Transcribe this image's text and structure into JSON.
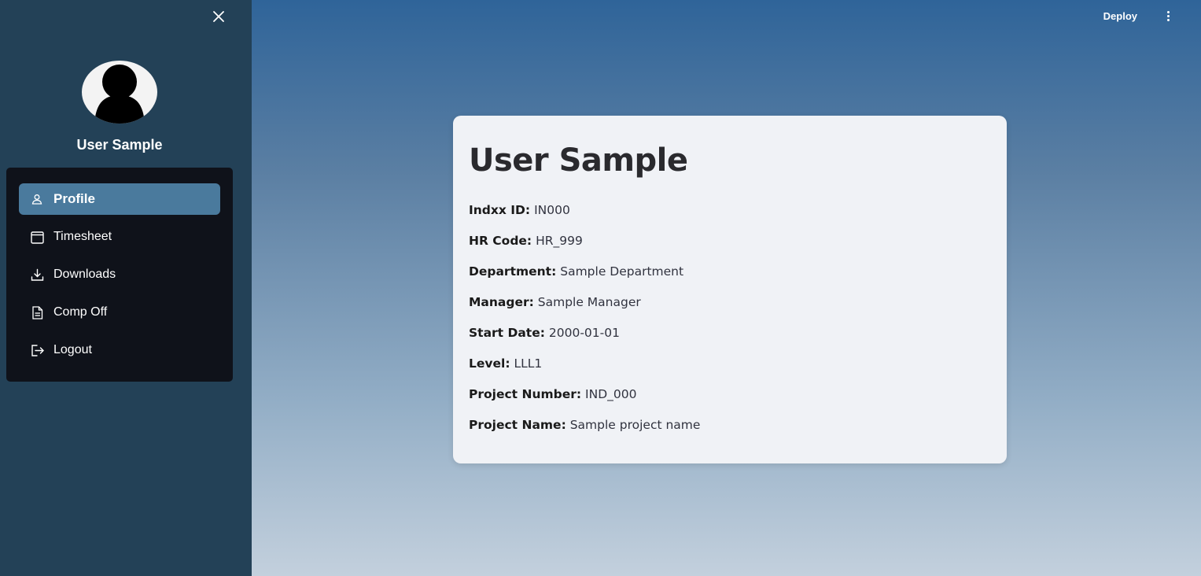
{
  "sidebar": {
    "user_name": "User Sample",
    "items": [
      {
        "label": "Profile",
        "icon": "person-icon",
        "active": true
      },
      {
        "label": "Timesheet",
        "icon": "calendar-icon",
        "active": false
      },
      {
        "label": "Downloads",
        "icon": "download-icon",
        "active": false
      },
      {
        "label": "Comp Off",
        "icon": "document-icon",
        "active": false
      },
      {
        "label": "Logout",
        "icon": "logout-icon",
        "active": false
      }
    ]
  },
  "topbar": {
    "deploy_label": "Deploy",
    "menu_icon": "vertical-dots-icon"
  },
  "profile": {
    "title": "User Sample",
    "fields": [
      {
        "label": "Indxx ID:",
        "value": "IN000"
      },
      {
        "label": "HR Code:",
        "value": "HR_999"
      },
      {
        "label": "Department:",
        "value": "Sample Department"
      },
      {
        "label": "Manager:",
        "value": "Sample Manager"
      },
      {
        "label": "Start Date:",
        "value": "2000-01-01"
      },
      {
        "label": "Level:",
        "value": "LLL1"
      },
      {
        "label": "Project Number:",
        "value": "IND_000"
      },
      {
        "label": "Project Name:",
        "value": "Sample project name"
      }
    ]
  },
  "colors": {
    "sidebar_bg": "#234157",
    "menu_bg": "#0f121a",
    "active_item": "#4a7a9d",
    "card_bg": "#f0f2f6"
  }
}
